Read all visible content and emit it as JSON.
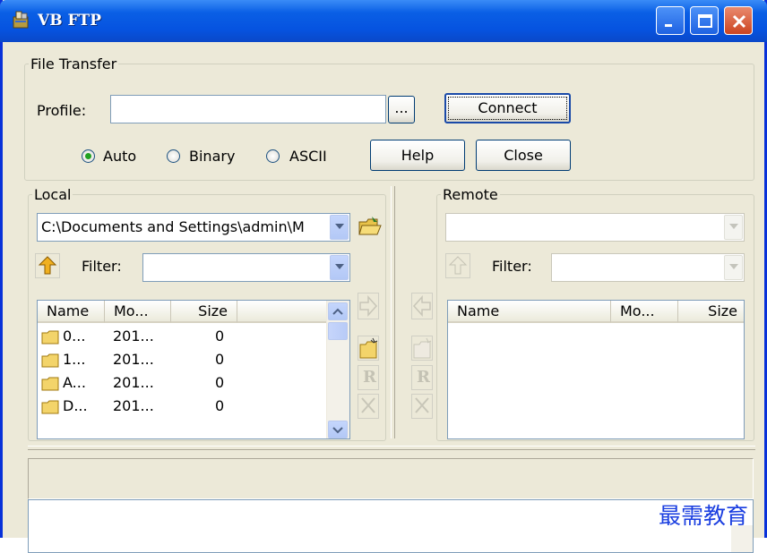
{
  "window": {
    "title": "VB FTP"
  },
  "file_transfer": {
    "group_label": "File Transfer",
    "profile_label": "Profile:",
    "profile_value": "",
    "browse_label": "...",
    "connect_label": "Connect",
    "modes": [
      {
        "label": "Auto",
        "selected": true
      },
      {
        "label": "Binary",
        "selected": false
      },
      {
        "label": "ASCII",
        "selected": false
      }
    ],
    "help_label": "Help",
    "close_label": "Close"
  },
  "local": {
    "group_label": "Local",
    "path": "C:\\Documents and Settings\\admin\\M",
    "filter_label": "Filter:",
    "filter_value": "",
    "columns": [
      "Name",
      "Mo...",
      "Size"
    ],
    "files": [
      {
        "name": "0...",
        "modified": "201...",
        "size": "0"
      },
      {
        "name": "1...",
        "modified": "201...",
        "size": "0"
      },
      {
        "name": "A...",
        "modified": "201...",
        "size": "0"
      },
      {
        "name": "D...",
        "modified": "201...",
        "size": "0"
      }
    ]
  },
  "remote": {
    "group_label": "Remote",
    "path": "",
    "filter_label": "Filter:",
    "filter_value": "",
    "columns": [
      "Name",
      "Mo...",
      "Size"
    ]
  },
  "toolbar": {
    "rename_glyph": "R"
  },
  "status": {
    "text": ""
  },
  "watermark": "最需教育",
  "colors": {
    "titlebar": "#0653e0",
    "face": "#ece9d8",
    "accent_blue": "#1a3ee0"
  }
}
